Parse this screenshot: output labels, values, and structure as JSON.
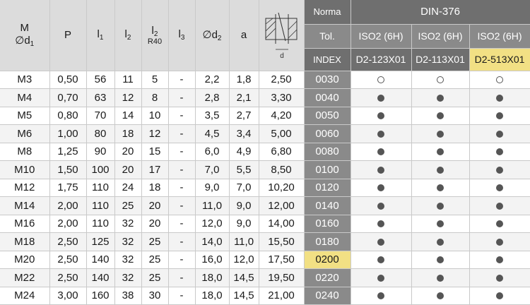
{
  "headers": {
    "m": "M",
    "d1": "∅d",
    "d1_sub": "1",
    "p": "P",
    "l1": "l",
    "l1_sub": "1",
    "l2": "l",
    "l2_sub": "2",
    "l2r40": "l",
    "l2r40_sub": "2",
    "l2r40_sub2": "R40",
    "l3": "l",
    "l3_sub": "3",
    "d2": "∅d",
    "d2_sub": "2",
    "a": "a",
    "diagram_label": "d",
    "norma": "Norma",
    "din": "DIN-376",
    "tol": "Tol.",
    "index": "INDEX",
    "tol_values": [
      "ISO2 (6H)",
      "ISO2 (6H)",
      "ISO2 (6H)"
    ],
    "codes": [
      "D2-123X01",
      "D2-113X01",
      "D2-513X01"
    ],
    "highlight_code": 2
  },
  "rows": [
    {
      "m": "M3",
      "p": "0,50",
      "l1": "56",
      "l2": "11",
      "l2r40": "5",
      "l3": "-",
      "d2": "2,2",
      "a": "1,8",
      "d": "2,50",
      "index": "0030",
      "marks": [
        "open",
        "open",
        "open"
      ]
    },
    {
      "m": "M4",
      "p": "0,70",
      "l1": "63",
      "l2": "12",
      "l2r40": "8",
      "l3": "-",
      "d2": "2,8",
      "a": "2,1",
      "d": "3,30",
      "index": "0040",
      "marks": [
        "filled",
        "filled",
        "filled"
      ]
    },
    {
      "m": "M5",
      "p": "0,80",
      "l1": "70",
      "l2": "14",
      "l2r40": "10",
      "l3": "-",
      "d2": "3,5",
      "a": "2,7",
      "d": "4,20",
      "index": "0050",
      "marks": [
        "filled",
        "filled",
        "filled"
      ]
    },
    {
      "m": "M6",
      "p": "1,00",
      "l1": "80",
      "l2": "18",
      "l2r40": "12",
      "l3": "-",
      "d2": "4,5",
      "a": "3,4",
      "d": "5,00",
      "index": "0060",
      "marks": [
        "filled",
        "filled",
        "filled"
      ]
    },
    {
      "m": "M8",
      "p": "1,25",
      "l1": "90",
      "l2": "20",
      "l2r40": "15",
      "l3": "-",
      "d2": "6,0",
      "a": "4,9",
      "d": "6,80",
      "index": "0080",
      "marks": [
        "filled",
        "filled",
        "filled"
      ]
    },
    {
      "m": "M10",
      "p": "1,50",
      "l1": "100",
      "l2": "20",
      "l2r40": "17",
      "l3": "-",
      "d2": "7,0",
      "a": "5,5",
      "d": "8,50",
      "index": "0100",
      "marks": [
        "filled",
        "filled",
        "filled"
      ]
    },
    {
      "m": "M12",
      "p": "1,75",
      "l1": "110",
      "l2": "24",
      "l2r40": "18",
      "l3": "-",
      "d2": "9,0",
      "a": "7,0",
      "d": "10,20",
      "index": "0120",
      "marks": [
        "filled",
        "filled",
        "filled"
      ]
    },
    {
      "m": "M14",
      "p": "2,00",
      "l1": "110",
      "l2": "25",
      "l2r40": "20",
      "l3": "-",
      "d2": "11,0",
      "a": "9,0",
      "d": "12,00",
      "index": "0140",
      "marks": [
        "filled",
        "filled",
        "filled"
      ]
    },
    {
      "m": "M16",
      "p": "2,00",
      "l1": "110",
      "l2": "32",
      "l2r40": "20",
      "l3": "-",
      "d2": "12,0",
      "a": "9,0",
      "d": "14,00",
      "index": "0160",
      "marks": [
        "filled",
        "filled",
        "filled"
      ]
    },
    {
      "m": "M18",
      "p": "2,50",
      "l1": "125",
      "l2": "32",
      "l2r40": "25",
      "l3": "-",
      "d2": "14,0",
      "a": "11,0",
      "d": "15,50",
      "index": "0180",
      "marks": [
        "filled",
        "filled",
        "filled"
      ]
    },
    {
      "m": "M20",
      "p": "2,50",
      "l1": "140",
      "l2": "32",
      "l2r40": "25",
      "l3": "-",
      "d2": "16,0",
      "a": "12,0",
      "d": "17,50",
      "index": "0200",
      "marks": [
        "filled",
        "filled",
        "filled"
      ],
      "highlight": true
    },
    {
      "m": "M22",
      "p": "2,50",
      "l1": "140",
      "l2": "32",
      "l2r40": "25",
      "l3": "-",
      "d2": "18,0",
      "a": "14,5",
      "d": "19,50",
      "index": "0220",
      "marks": [
        "filled",
        "filled",
        "filled"
      ]
    },
    {
      "m": "M24",
      "p": "3,00",
      "l1": "160",
      "l2": "38",
      "l2r40": "30",
      "l3": "-",
      "d2": "18,0",
      "a": "14,5",
      "d": "21,00",
      "index": "0240",
      "marks": [
        "filled",
        "filled",
        "filled"
      ]
    }
  ]
}
